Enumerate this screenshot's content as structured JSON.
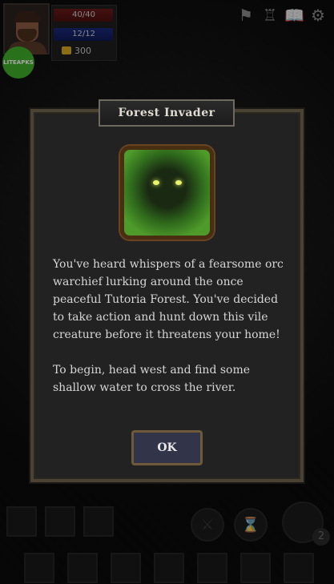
{
  "hud": {
    "hp": "40/40",
    "mp": "12/12",
    "gold": "300",
    "badge_text": "LITEAPKS",
    "top_icons": [
      "map-icon",
      "character-icon",
      "journal-icon",
      "gear-icon"
    ]
  },
  "dialog": {
    "title": "Forest Invader",
    "paragraph1": "You've heard whispers of a fearsome orc warchief lurking around the once peaceful Tutoria Forest. You've decided to take action and hunt down this vile creature before it threatens your home!",
    "paragraph2": "To begin, head west and find some shallow water to cross the river.",
    "ok_label": "OK",
    "icon": "forest-creature-icon"
  },
  "bottom": {
    "count": "2"
  },
  "colors": {
    "hp_bar": "#6a1a1a",
    "mp_bar": "#1a2a7a",
    "gold": "#d8a820",
    "badge": "#3fae2a",
    "dialog_border": "#4a4334",
    "ok_button": "#32344a"
  }
}
